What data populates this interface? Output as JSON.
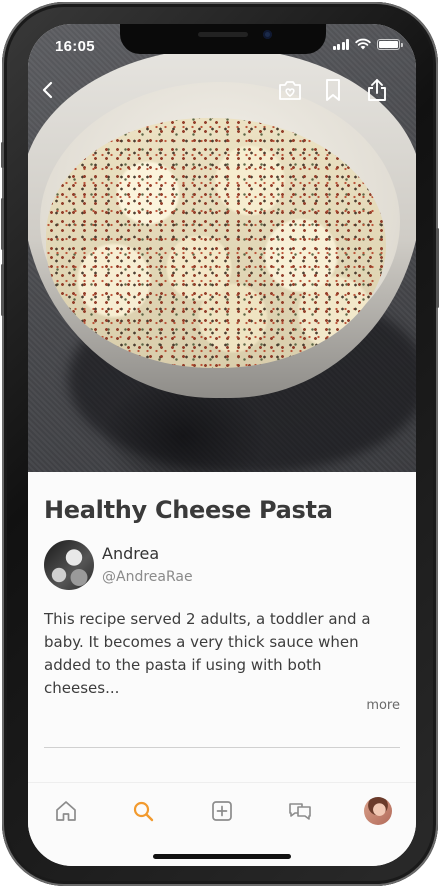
{
  "status_bar": {
    "time": "16:05"
  },
  "hero": {
    "back_icon": "chevron-left-icon",
    "actions": [
      "camera-heart-icon",
      "bookmark-icon",
      "share-icon"
    ]
  },
  "recipe": {
    "title": "Healthy Cheese Pasta",
    "author_name": "Andrea",
    "author_handle": "@AndreaRae",
    "description": "This recipe served 2 adults, a toddler and a baby. It becomes a very thick sauce when added to the pasta if using with both cheeses...",
    "more_label": "more"
  },
  "tab_bar": {
    "active_tab": "search",
    "active_color": "#f29a2e",
    "inactive_color": "#8c8c8c",
    "items": [
      "home-icon",
      "search-icon",
      "add-icon",
      "chat-icon",
      "profile-avatar"
    ]
  }
}
